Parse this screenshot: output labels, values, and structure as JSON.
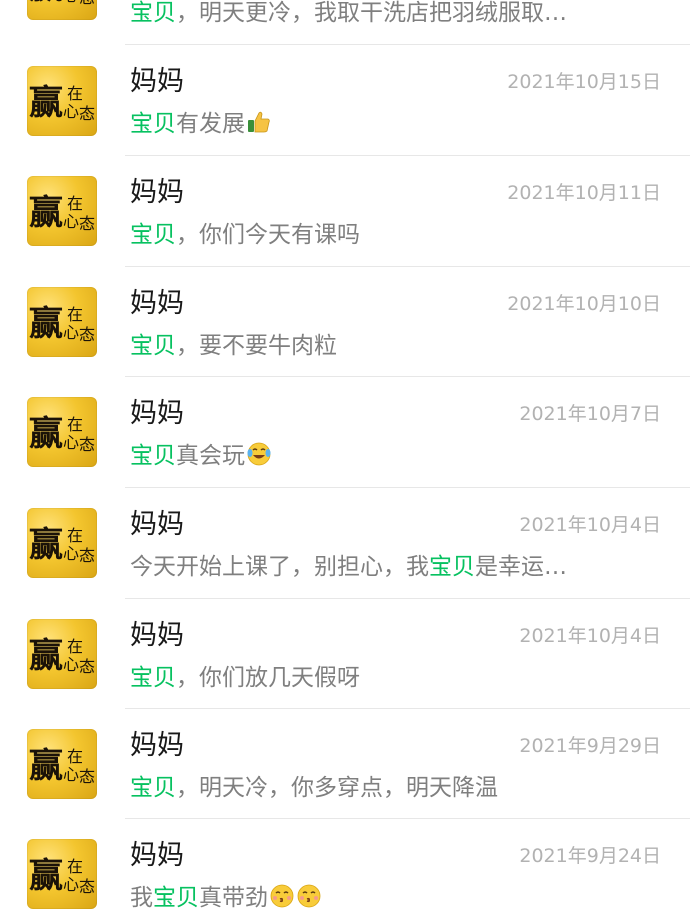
{
  "items": [
    {
      "name": "",
      "date": "",
      "message": {
        "pre": "",
        "hl": "宝贝",
        "post": "，明天更冷，我取干洗店把羽绒服取…"
      },
      "emoji": []
    },
    {
      "name": "妈妈",
      "date": "2021年10月15日",
      "message": {
        "pre": "",
        "hl": "宝贝",
        "post": "有发展"
      },
      "emoji": [
        "thumbs-up-icon"
      ]
    },
    {
      "name": "妈妈",
      "date": "2021年10月11日",
      "message": {
        "pre": "",
        "hl": "宝贝",
        "post": "，你们今天有课吗"
      },
      "emoji": []
    },
    {
      "name": "妈妈",
      "date": "2021年10月10日",
      "message": {
        "pre": "",
        "hl": "宝贝",
        "post": "，要不要牛肉粒"
      },
      "emoji": []
    },
    {
      "name": "妈妈",
      "date": "2021年10月7日",
      "message": {
        "pre": "",
        "hl": "宝贝",
        "post": "真会玩"
      },
      "emoji": [
        "laughing-crying-emoji-icon"
      ]
    },
    {
      "name": "妈妈",
      "date": "2021年10月4日",
      "message": {
        "pre": "今天开始上课了，别担心，我",
        "hl": "宝贝",
        "post": "是幸运…"
      },
      "emoji": []
    },
    {
      "name": "妈妈",
      "date": "2021年10月4日",
      "message": {
        "pre": "",
        "hl": "宝贝",
        "post": "，你们放几天假呀"
      },
      "emoji": []
    },
    {
      "name": "妈妈",
      "date": "2021年9月29日",
      "message": {
        "pre": "",
        "hl": "宝贝",
        "post": "，明天冷，你多穿点，明天降温"
      },
      "emoji": []
    },
    {
      "name": "妈妈",
      "date": "2021年9月24日",
      "message": {
        "pre": "我",
        "hl": "宝贝",
        "post": "真带劲"
      },
      "emoji": [
        "kissing-face-icon",
        "kissing-face-icon"
      ]
    }
  ],
  "avatar": {
    "text_main": "赢",
    "text_small": [
      "在",
      "心",
      "态"
    ]
  },
  "colors": {
    "highlight": "#07c160",
    "name": "#191919",
    "message": "#7f7f7f",
    "date": "#b2b2b2",
    "divider": "#e7e7e7"
  }
}
